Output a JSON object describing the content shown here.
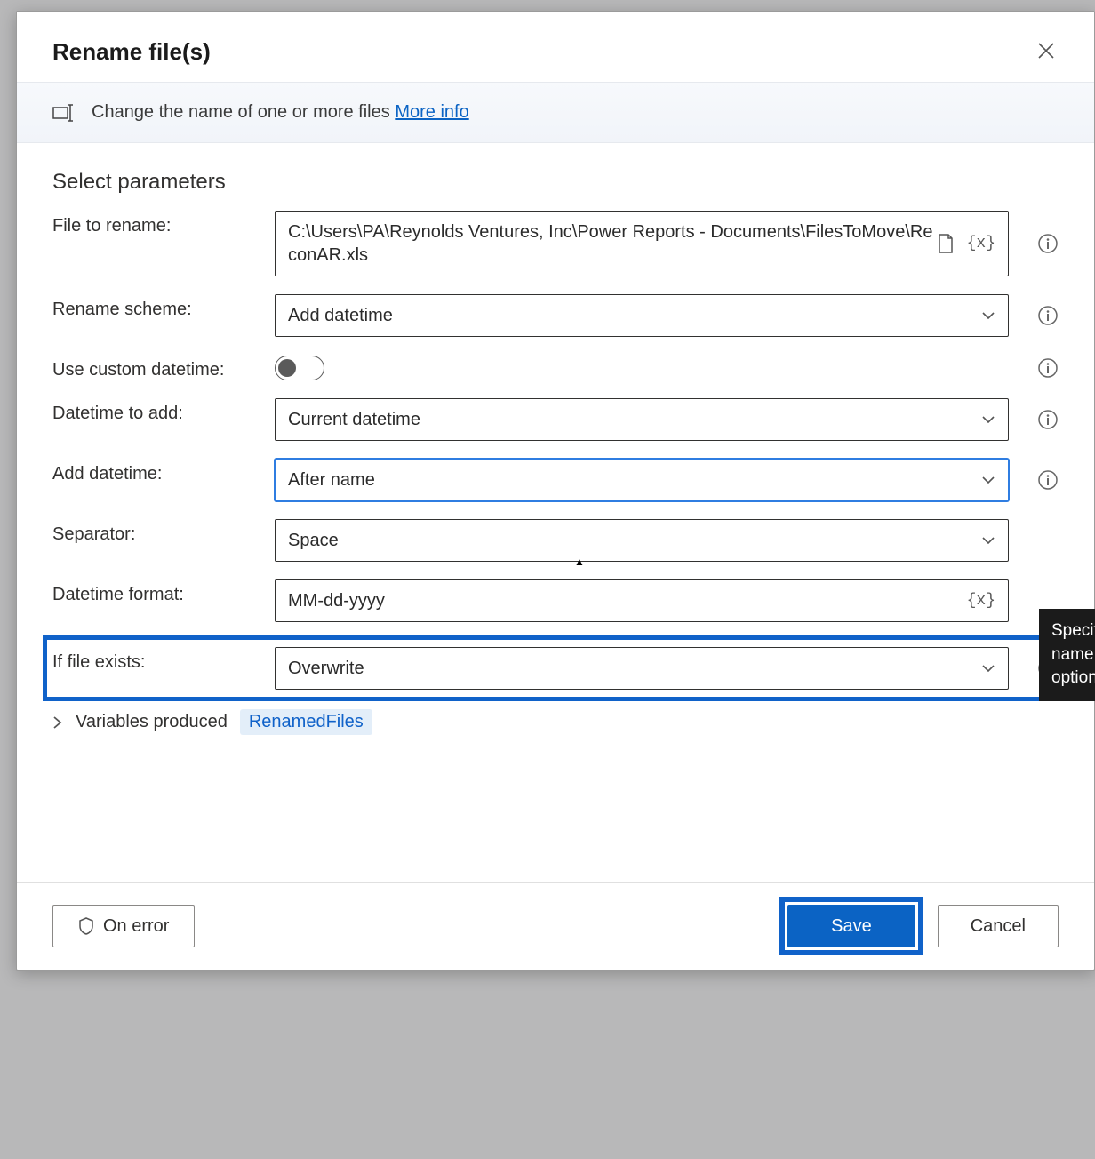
{
  "header": {
    "title": "Rename file(s)",
    "description": "Change the name of one or more files",
    "more_info": "More info"
  },
  "section_title": "Select parameters",
  "labels": {
    "file_to_rename": "File to rename:",
    "rename_scheme": "Rename scheme:",
    "use_custom_datetime": "Use custom datetime:",
    "datetime_to_add": "Datetime to add:",
    "add_datetime": "Add datetime:",
    "separator": "Separator:",
    "datetime_format": "Datetime format:",
    "if_file_exists": "If file exists:",
    "variables_produced": "Variables produced"
  },
  "values": {
    "file_to_rename": "C:\\Users\\PA\\Reynolds Ventures, Inc\\Power Reports - Documents\\FilesToMove\\ReconAR.xls",
    "rename_scheme": "Add datetime",
    "use_custom_datetime": false,
    "datetime_to_add": "Current datetime",
    "add_datetime": "After name",
    "separator": "Space",
    "datetime_format": "MM-dd-yyyy",
    "if_file_exists": "Overwrite"
  },
  "variables": {
    "renamed_files": "RenamedFiles"
  },
  "tooltip": {
    "line1": "Specif",
    "line2": "name",
    "line3": "option"
  },
  "footer": {
    "on_error": "On error",
    "save": "Save",
    "cancel": "Cancel"
  },
  "var_token": "{x}"
}
